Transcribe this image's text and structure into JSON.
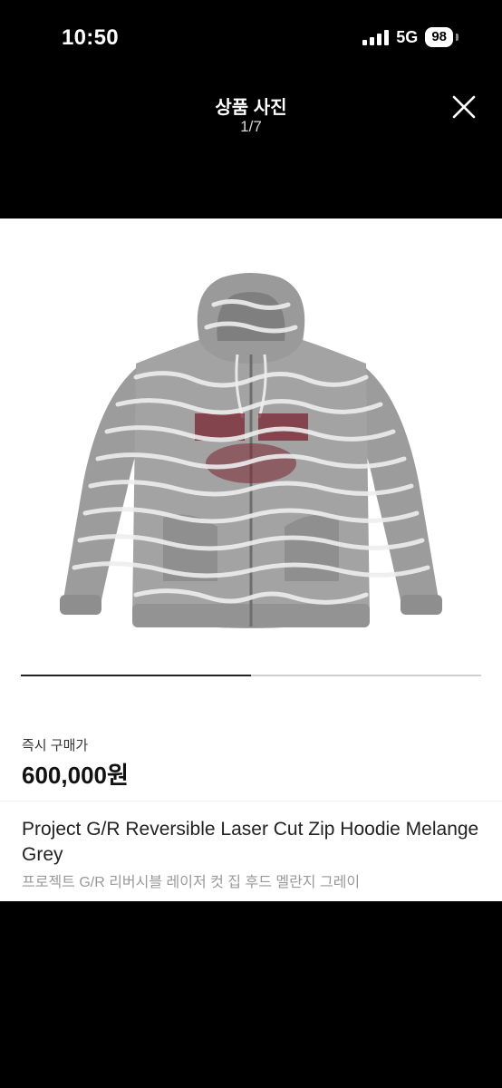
{
  "status_bar": {
    "time": "10:50",
    "network": "5G",
    "battery": "98"
  },
  "header": {
    "title": "상품 사진",
    "counter": "1/7",
    "close_icon": "close-icon"
  },
  "viewer": {
    "image_icon": "hoodie-photo",
    "current_index": 1,
    "total": 7,
    "progress": 0.5
  },
  "product": {
    "price_label": "즉시 구매가",
    "price": "600,000원",
    "name_en": "Project G/R Reversible Laser Cut Zip Hoodie Melange Grey",
    "name_ko": "프로젝트 G/R 리버시블 레이저 컷 집 후드 멜란지 그레이"
  },
  "colors": {
    "background": "#000000",
    "panel": "#ffffff",
    "hoodie": "#9c9c9c",
    "graphic": "#7a2430"
  }
}
